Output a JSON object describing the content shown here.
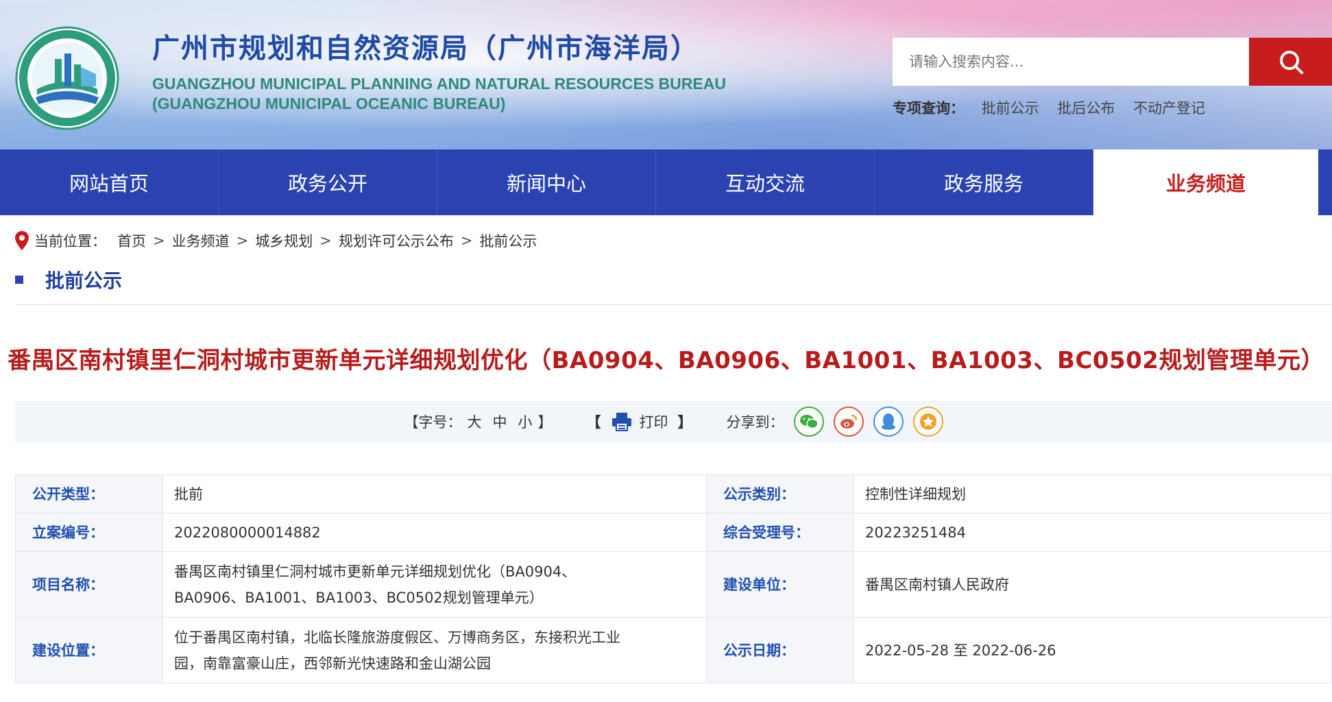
{
  "header": {
    "title_cn": "广州市规划和自然资源局（广州市海洋局）",
    "title_en_1": "GUANGZHOU MUNICIPAL PLANNING AND NATURAL RESOURCES BUREAU",
    "title_en_2": "(GUANGZHOU MUNICIPAL OCEANIC BUREAU)",
    "search_placeholder": "请输入搜索内容...",
    "special_label": "专项查询：",
    "special_links": [
      "批前公示",
      "批后公布",
      "不动产登记"
    ]
  },
  "nav": {
    "items": [
      "网站首页",
      "政务公开",
      "新闻中心",
      "互动交流",
      "政务服务",
      "业务频道"
    ],
    "active": "业务频道"
  },
  "breadcrumb": {
    "label": "当前位置：",
    "items": [
      "首页",
      "业务频道",
      "城乡规划",
      "规划许可公示公布",
      "批前公示"
    ],
    "separator": ">"
  },
  "section_title": "批前公示",
  "article_title": "番禺区南村镇里仁洞村城市更新单元详细规划优化（BA0904、BA0906、BA1001、BA1003、BC0502规划管理单元）",
  "tools": {
    "font_label": "【字号：",
    "font_sizes": [
      "大",
      "中",
      "小"
    ],
    "font_close": "】",
    "print_open": "【",
    "print_label": "打印",
    "print_close": "】",
    "share_label": "分享到：",
    "share_icons": [
      "wechat-icon",
      "weibo-icon",
      "qq-icon",
      "favorite-icon"
    ]
  },
  "info": {
    "r1": {
      "k1": "公开类型：",
      "v1": "批前",
      "k2": "公示类别：",
      "v2": "控制性详细规划"
    },
    "r2": {
      "k1": "立案编号：",
      "v1": "2022080000014882",
      "k2": "综合受理号：",
      "v2": "20223251484"
    },
    "r3": {
      "k1": "项目名称：",
      "v1a": "番禺区南村镇里仁洞村城市更新单元详细规划优化（BA0904、",
      "v1b": "BA0906、BA1001、BA1003、BC0502规划管理单元）",
      "k2": "建设单位：",
      "v2": "番禺区南村镇人民政府"
    },
    "r4": {
      "k1": "建设位置：",
      "v1a": "位于番禺区南村镇，北临长隆旅游度假区、万博商务区，东接积光工业",
      "v1b": "园，南靠富豪山庄，西邻新光快速路和金山湖公园",
      "k2": "公示日期：",
      "v2": "2022-05-28 至 2022-06-26"
    }
  },
  "colors": {
    "nav_blue": "#2b43b0",
    "accent_red": "#c71d1d",
    "title_red": "#b71c1c",
    "key_blue": "#1f4fb0"
  }
}
